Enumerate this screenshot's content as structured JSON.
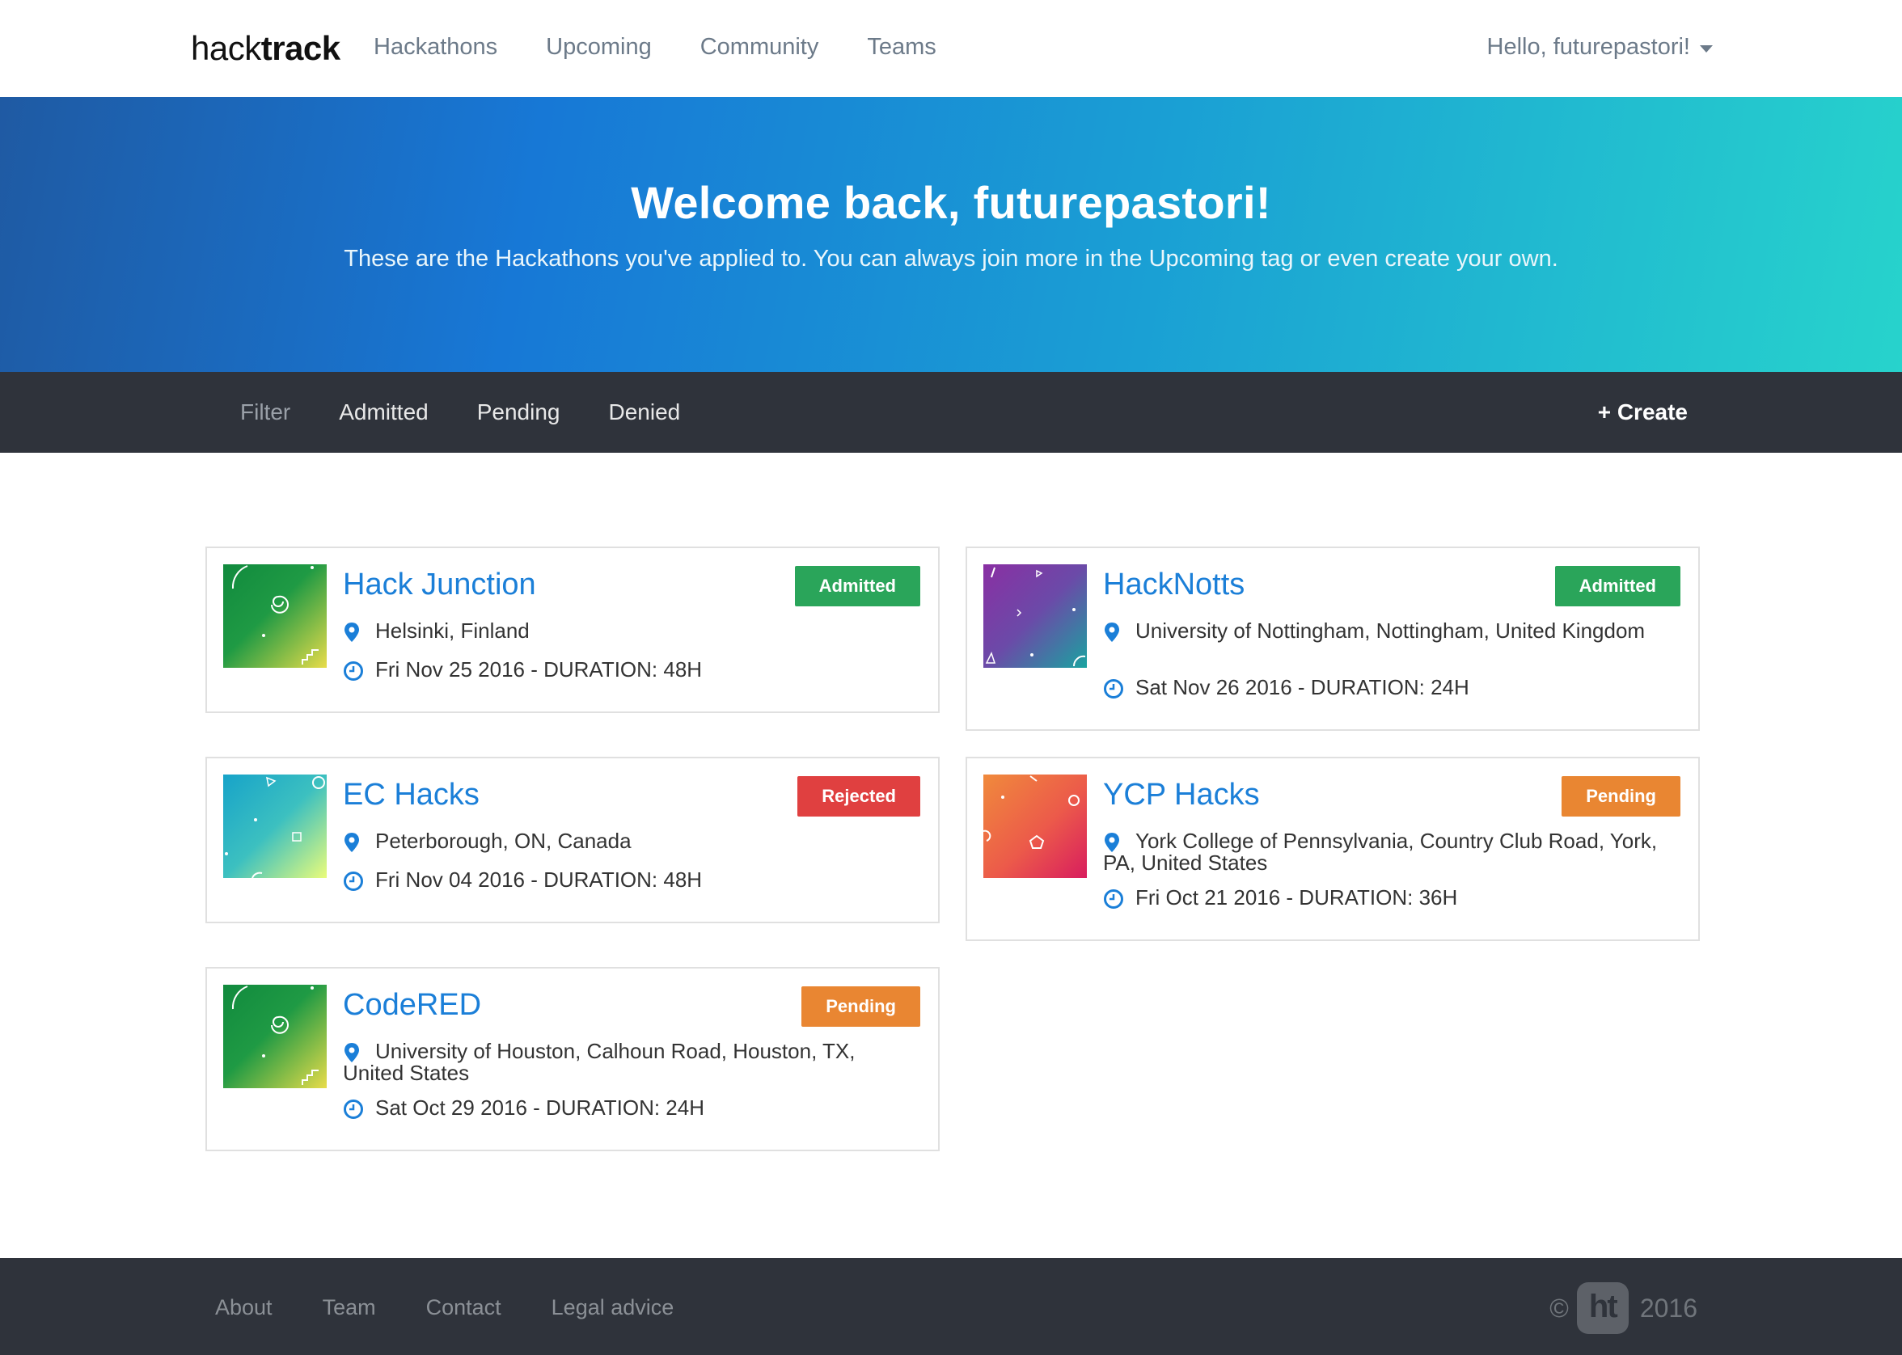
{
  "brand": {
    "light": "hack",
    "bold": "track"
  },
  "nav": {
    "items": [
      "Hackathons",
      "Upcoming",
      "Community",
      "Teams"
    ]
  },
  "user": {
    "greeting": "Hello, futurepastori!"
  },
  "hero": {
    "title": "Welcome back, futurepastori!",
    "subtitle": "These are the Hackathons you've applied to. You can always join more in the Upcoming tag or even create your own."
  },
  "filter": {
    "label": "Filter",
    "options": [
      "Admitted",
      "Pending",
      "Denied"
    ],
    "create": "Create"
  },
  "hackathons": [
    {
      "name": "Hack Junction",
      "status": "Admitted",
      "location": "Helsinki, Finland",
      "date": "Fri Nov 25 2016 - DURATION: 48H"
    },
    {
      "name": "HackNotts",
      "status": "Admitted",
      "location": "University of Nottingham, Nottingham, United Kingdom",
      "date": "Sat Nov 26 2016 - DURATION: 24H"
    },
    {
      "name": "EC Hacks",
      "status": "Rejected",
      "location": "Peterborough, ON, Canada",
      "date": "Fri Nov 04 2016 - DURATION: 48H"
    },
    {
      "name": "YCP Hacks",
      "status": "Pending",
      "location": "York College of Pennsylvania, Country Club Road, York, PA, United States",
      "date": "Fri Oct 21 2016 - DURATION: 36H"
    },
    {
      "name": "CodeRED",
      "status": "Pending",
      "location": "University of Houston, Calhoun Road, Houston, TX, United States",
      "date": "Sat Oct 29 2016 - DURATION: 24H"
    }
  ],
  "footer": {
    "links": [
      "About",
      "Team",
      "Contact",
      "Legal advice"
    ],
    "copyright_symbol": "©",
    "logo": "ht",
    "year": "2016"
  },
  "colors": {
    "link_blue": "#1b7fd8",
    "admitted": "#2aa55a",
    "rejected": "#e04040",
    "pending": "#e98632",
    "dark_bar": "#2f333b"
  }
}
